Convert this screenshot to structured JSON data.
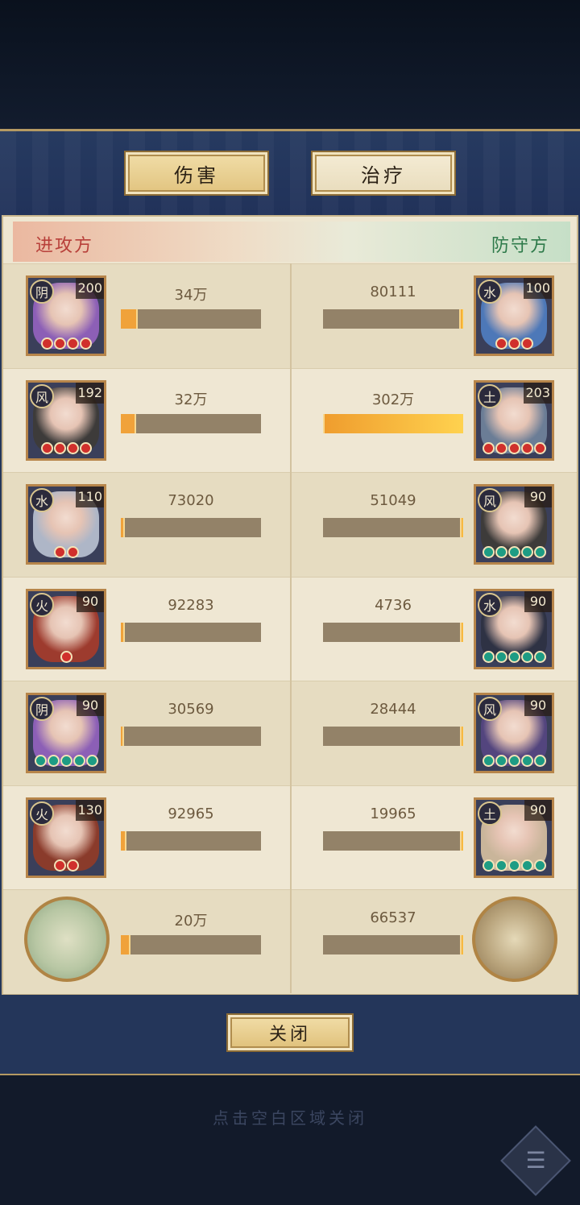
{
  "tabs": {
    "damage": "伤害",
    "heal": "治疗"
  },
  "sides": {
    "attack": "进攻方",
    "defend": "防守方"
  },
  "rows": [
    {
      "left": {
        "elem": "阴",
        "level": "200",
        "stars": 4,
        "star_color": "red",
        "value": "34万",
        "fill": 0.12,
        "art": "#8c5fb6"
      },
      "right": {
        "elem": "水",
        "level": "100",
        "stars": 3,
        "star_color": "red",
        "value": "80111",
        "fill": 0.03,
        "art": "#4d78b8"
      }
    },
    {
      "left": {
        "elem": "风",
        "level": "192",
        "stars": 4,
        "star_color": "red",
        "value": "32万",
        "fill": 0.11,
        "art": "#3d3b3a"
      },
      "right": {
        "elem": "土",
        "level": "203",
        "stars": 5,
        "star_color": "red",
        "value": "302万",
        "fill": 1.0,
        "art": "#6b7d96"
      }
    },
    {
      "left": {
        "elem": "水",
        "level": "110",
        "stars": 2,
        "star_color": "red",
        "value": "73020",
        "fill": 0.03,
        "art": "#aeb6c7"
      },
      "right": {
        "elem": "风",
        "level": "90",
        "stars": 5,
        "star_color": "green",
        "value": "51049",
        "fill": 0.02,
        "art": "#3d3b3a"
      }
    },
    {
      "left": {
        "elem": "火",
        "level": "90",
        "stars": 1,
        "star_color": "red",
        "value": "92283",
        "fill": 0.03,
        "art": "#9d3b2e"
      },
      "right": {
        "elem": "水",
        "level": "90",
        "stars": 5,
        "star_color": "green",
        "value": "4736",
        "fill": 0.0,
        "art": "#2e3244"
      }
    },
    {
      "left": {
        "elem": "阴",
        "level": "90",
        "stars": 5,
        "star_color": "green",
        "value": "30569",
        "fill": 0.01,
        "art": "#8c5fb6"
      },
      "right": {
        "elem": "风",
        "level": "90",
        "stars": 5,
        "star_color": "green",
        "value": "28444",
        "fill": 0.01,
        "art": "#53457e"
      }
    },
    {
      "left": {
        "elem": "火",
        "level": "130",
        "stars": 2,
        "star_color": "red",
        "value": "92965",
        "fill": 0.04,
        "art": "#8a3b2b"
      },
      "right": {
        "elem": "土",
        "level": "90",
        "stars": 5,
        "star_color": "green",
        "value": "19965",
        "fill": 0.0,
        "art": "#c9b59a"
      }
    },
    {
      "left": {
        "round": true,
        "value": "20万",
        "fill": 0.07
      },
      "right": {
        "round": true,
        "value": "66537",
        "fill": 0.02
      }
    }
  ],
  "close_label": "关闭",
  "hint": "点击空白区域关闭",
  "colors": {
    "panel": "#24365a",
    "board": "#eee6d1",
    "bar_fill": "#f0a23a",
    "attack_text": "#b8403a",
    "defend_text": "#2e7a4a"
  }
}
